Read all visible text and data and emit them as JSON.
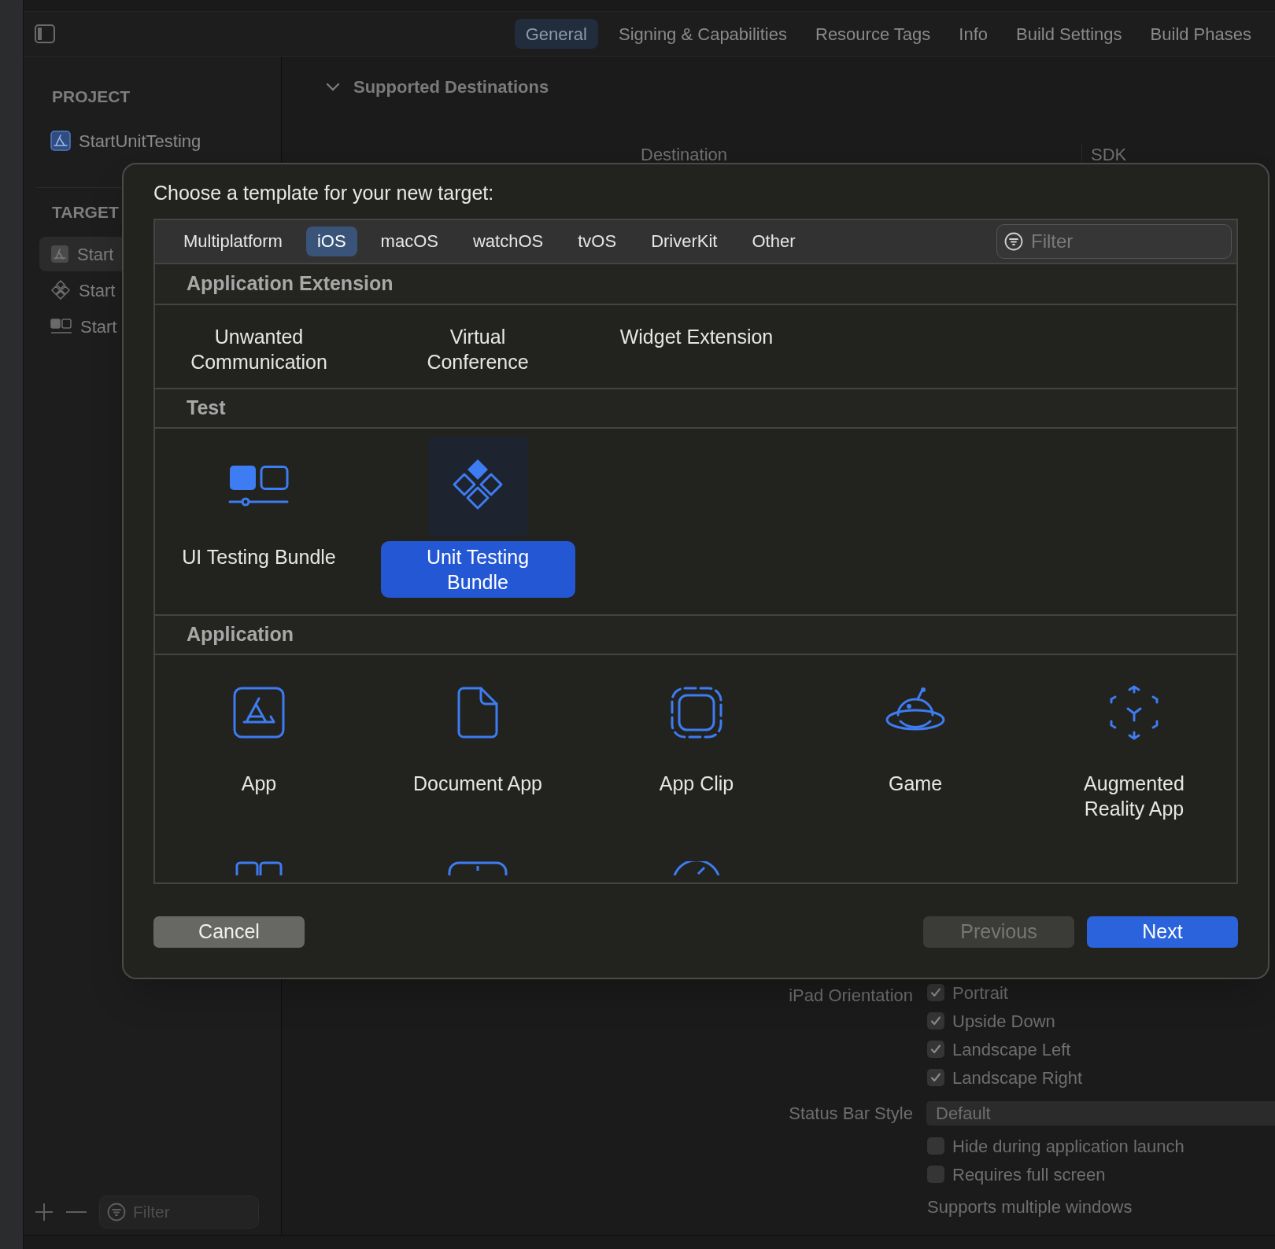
{
  "editor_tabs": [
    {
      "label": "General",
      "selected": true
    },
    {
      "label": "Signing & Capabilities",
      "selected": false
    },
    {
      "label": "Resource Tags",
      "selected": false
    },
    {
      "label": "Info",
      "selected": false
    },
    {
      "label": "Build Settings",
      "selected": false
    },
    {
      "label": "Build Phases",
      "selected": false
    }
  ],
  "sidebar": {
    "project_heading": "PROJECT",
    "project": {
      "name": "StartUnitTesting"
    },
    "targets_heading": "TARGET",
    "targets": [
      {
        "name": "Start",
        "selected": true
      },
      {
        "name": "Start",
        "selected": false
      },
      {
        "name": "Start",
        "selected": false
      }
    ],
    "filter": {
      "placeholder": "Filter"
    }
  },
  "section": {
    "title": "Supported Destinations",
    "expanded": true,
    "columns": [
      "Destination",
      "SDK"
    ]
  },
  "dialog": {
    "title": "Choose a template for your new target:",
    "platforms": [
      {
        "label": "Multiplatform",
        "selected": false
      },
      {
        "label": "iOS",
        "selected": true
      },
      {
        "label": "macOS",
        "selected": false
      },
      {
        "label": "watchOS",
        "selected": false
      },
      {
        "label": "tvOS",
        "selected": false
      },
      {
        "label": "DriverKit",
        "selected": false
      },
      {
        "label": "Other",
        "selected": false
      }
    ],
    "filter": {
      "placeholder": "Filter"
    },
    "sections": [
      {
        "title": "Application Extension",
        "items": [
          {
            "label": "Unwanted\nCommunication",
            "selected": false
          },
          {
            "label": "Virtual\nConference",
            "selected": false
          },
          {
            "label": "Widget Extension",
            "selected": false
          }
        ]
      },
      {
        "title": "Test",
        "items": [
          {
            "label": "UI Testing Bundle",
            "selected": false
          },
          {
            "label": "Unit Testing\nBundle",
            "selected": true
          }
        ]
      },
      {
        "title": "Application",
        "items": [
          {
            "label": "App",
            "selected": false
          },
          {
            "label": "Document App",
            "selected": false
          },
          {
            "label": "App Clip",
            "selected": false
          },
          {
            "label": "Game",
            "selected": false
          },
          {
            "label": "Augmented\nReality App",
            "selected": false
          }
        ]
      }
    ],
    "cancel": {
      "label": "Cancel"
    },
    "previous": {
      "label": "Previous",
      "disabled": true
    },
    "next": {
      "label": "Next"
    }
  },
  "orientation": {
    "label": "iPad Orientation",
    "options": [
      {
        "label": "Portrait",
        "checked": true
      },
      {
        "label": "Upside Down",
        "checked": true
      },
      {
        "label": "Landscape Left",
        "checked": true
      },
      {
        "label": "Landscape Right",
        "checked": true
      }
    ]
  },
  "status_bar_style": {
    "label": "Status Bar Style",
    "value": "Default",
    "options": [
      {
        "label": "Hide during application launch",
        "checked": false
      },
      {
        "label": "Requires full screen",
        "checked": false
      }
    ]
  },
  "multiple_windows": {
    "label": "Supports multiple windows"
  }
}
